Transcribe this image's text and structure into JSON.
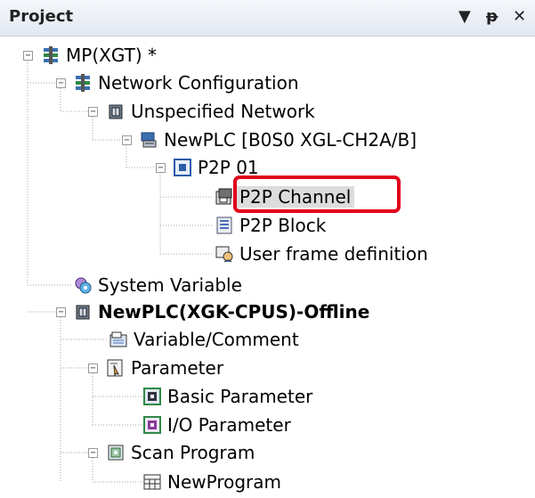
{
  "panel": {
    "title": "Project",
    "dropdown_icon": "dropdown-arrow-icon",
    "pin_icon": "pin-icon",
    "close_icon": "close-icon"
  },
  "tree": {
    "root": "MP(XGT) *",
    "network_configuration": "Network Configuration",
    "unspecified_network": "Unspecified Network",
    "newplc_module": "NewPLC [B0S0 XGL-CH2A/B]",
    "p2p_01": "P2P 01",
    "p2p_channel": "P2P Channel",
    "p2p_block": "P2P Block",
    "user_frame": "User frame definition",
    "system_variable": "System Variable",
    "plc_offline": "NewPLC(XGK-CPUS)-Offline",
    "variable_comment": "Variable/Comment",
    "parameter": "Parameter",
    "basic_parameter": "Basic Parameter",
    "io_parameter": "I/O Parameter",
    "scan_program": "Scan Program",
    "new_program": "NewProgram"
  },
  "expander": {
    "collapse_symbol": "−"
  },
  "colors": {
    "highlight": "#e2001a",
    "selection": "#dcdcdc"
  }
}
